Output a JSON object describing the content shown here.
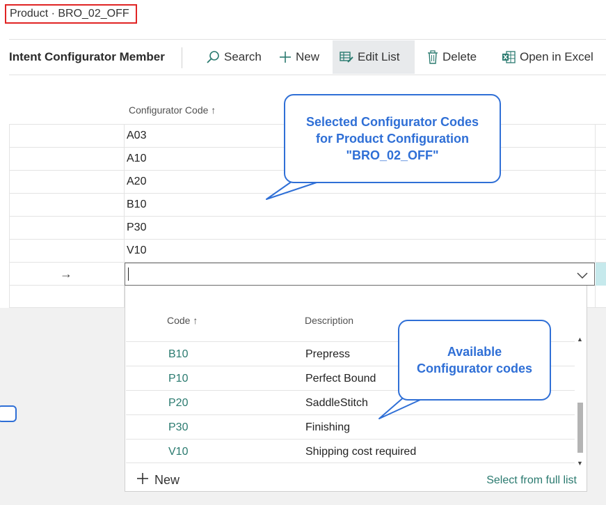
{
  "breadcrumb": "Product · BRO_02_OFF",
  "page": {
    "title": "Intent Configurator Member"
  },
  "toolbar": {
    "search": "Search",
    "new": "New",
    "edit_list": "Edit List",
    "delete": "Delete",
    "open_excel": "Open in Excel"
  },
  "list": {
    "column_header": "Configurator Code ↑",
    "rows": [
      "A03",
      "A10",
      "A20",
      "B10",
      "P30",
      "V10"
    ],
    "input_value": ""
  },
  "dropdown": {
    "col_code": "Code ↑",
    "col_description": "Description",
    "rows": [
      {
        "code": "B10",
        "description": "Prepress"
      },
      {
        "code": "P10",
        "description": "Perfect Bound"
      },
      {
        "code": "P20",
        "description": "SaddleStitch"
      },
      {
        "code": "P30",
        "description": "Finishing"
      },
      {
        "code": "V10",
        "description": "Shipping cost required"
      }
    ],
    "new_label": "New",
    "full_list_label": "Select from full list"
  },
  "callouts": {
    "selected_line1": "Selected Configurator Codes",
    "selected_line2": "for Product Configuration",
    "selected_line3": "\"BRO_02_OFF\"",
    "available_line1": "Available",
    "available_line2": "Configurator codes"
  },
  "colors": {
    "accent_blue": "#2f6fd6",
    "link_teal": "#2a7a6f",
    "highlight_red": "#e02424"
  }
}
